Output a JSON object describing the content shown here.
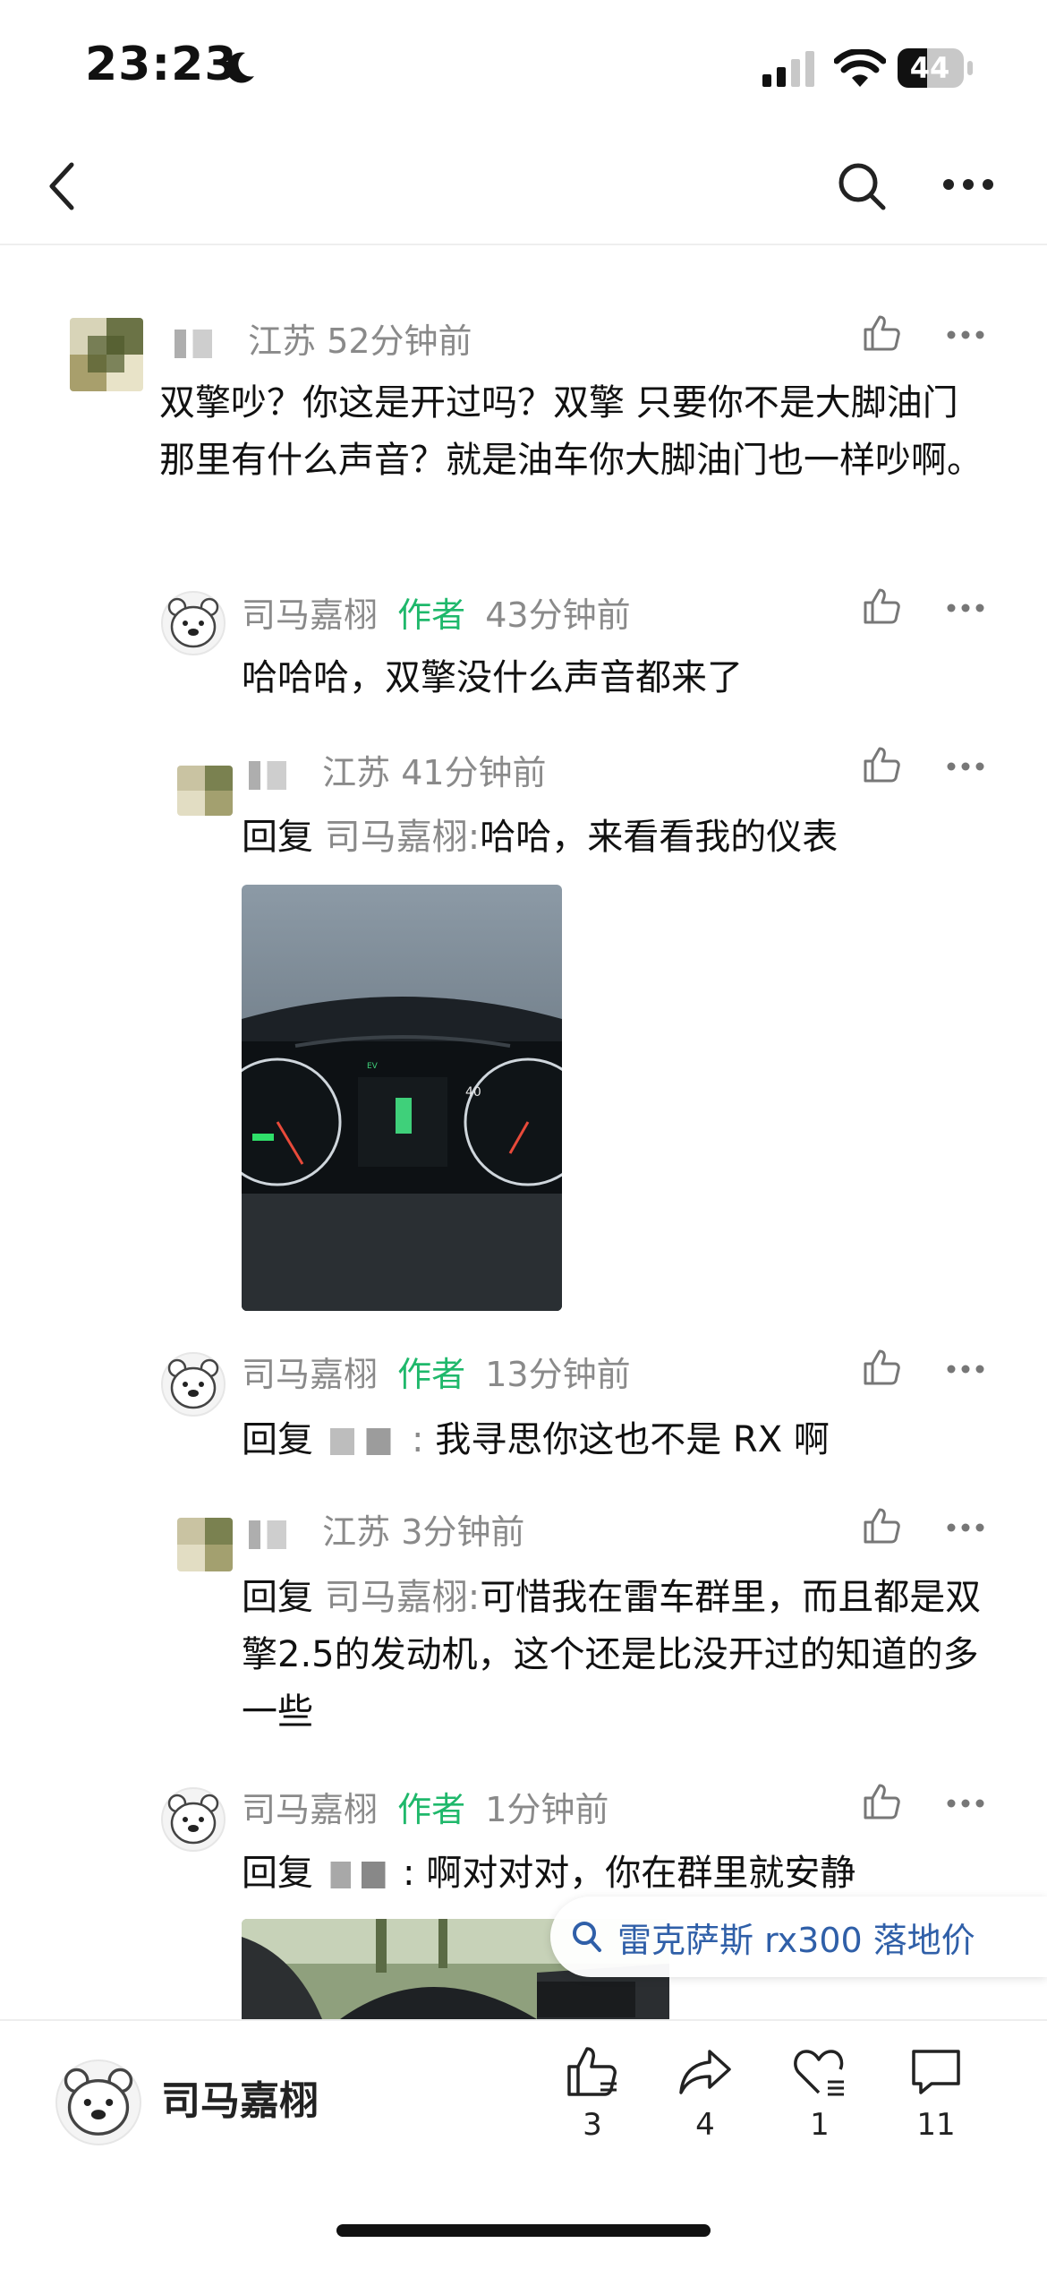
{
  "status_bar": {
    "time": "23:23",
    "battery": "44"
  },
  "comments": [
    {
      "location": "江苏",
      "time": "52分钟前",
      "text": "双擎吵？你这是开过吗？双擎 只要你不是大脚油门那里有什么声音？就是油车你大脚油门也一样吵啊。"
    },
    {
      "name": "司马嘉栩",
      "author_badge": "作者",
      "time": "43分钟前",
      "text": "哈哈哈，双擎没什么声音都来了"
    },
    {
      "location": "江苏",
      "time": "41分钟前",
      "reply_label": "回复",
      "reply_to": "司马嘉栩:",
      "text": "哈哈，来看看我的仪表"
    },
    {
      "name": "司马嘉栩",
      "author_badge": "作者",
      "time": "13分钟前",
      "reply_label": "回复",
      "text": "我寻思你这也不是 RX 啊"
    },
    {
      "location": "江苏",
      "time": "3分钟前",
      "reply_label": "回复",
      "reply_to": "司马嘉栩:",
      "text": "可惜我在雷车群里，而且都是双擎2.5的发动机，这个还是比没开过的知道的多一些"
    },
    {
      "name": "司马嘉栩",
      "author_badge": "作者",
      "time": "1分钟前",
      "reply_label": "回复",
      "text": "啊对对对，你在群里就安静"
    }
  ],
  "search_suggestion": "雷克萨斯 rx300 落地价",
  "bottom_bar": {
    "author_name": "司马嘉栩",
    "like_count": "3",
    "share_count": "4",
    "favorite_count": "1",
    "comment_count": "11"
  }
}
